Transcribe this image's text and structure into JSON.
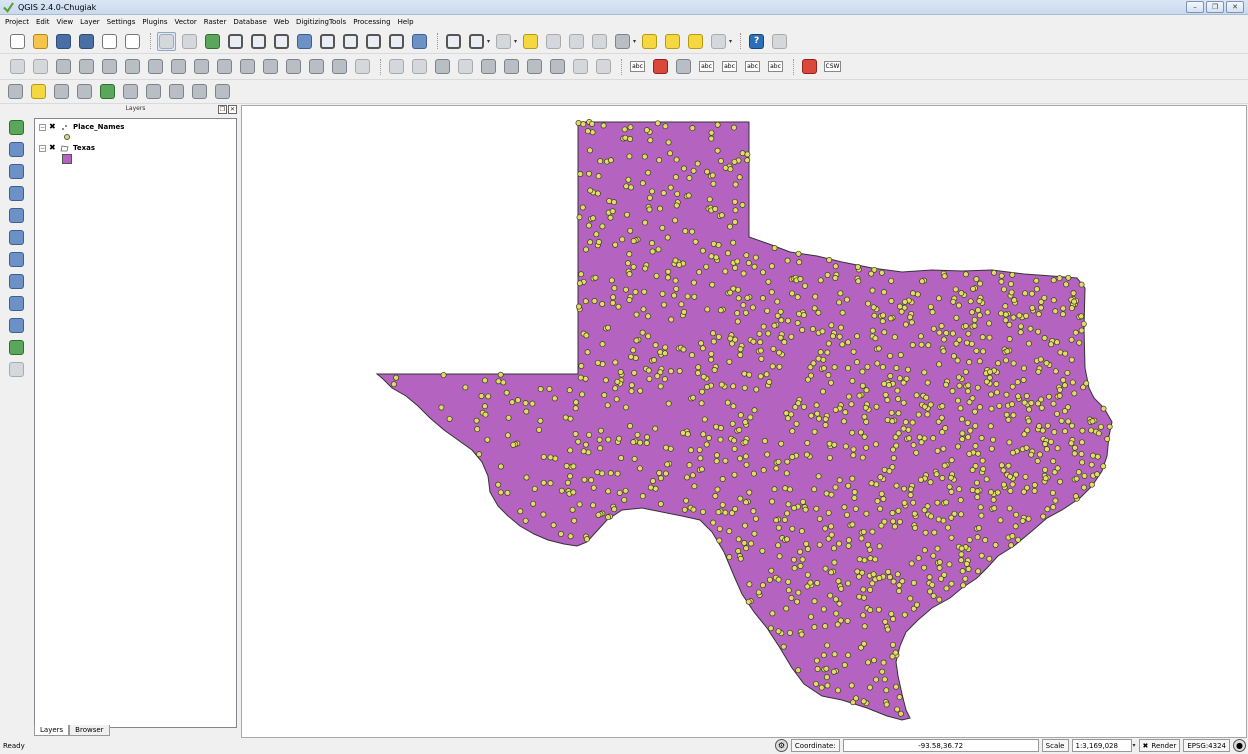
{
  "window": {
    "title": "QGIS 2.4.0-Chugiak",
    "buttons": [
      "–",
      "❐",
      "✕"
    ]
  },
  "menu": [
    "Project",
    "Edit",
    "View",
    "Layer",
    "Settings",
    "Plugins",
    "Vector",
    "Raster",
    "Database",
    "Web",
    "DigitizingTools",
    "Processing",
    "Help"
  ],
  "toolbar_labels": {
    "csw": "CSW",
    "label_a": "abc",
    "label_b": "abc",
    "label_c": "abc",
    "label_d": "abc",
    "label_e": "abc"
  },
  "layers_panel": {
    "title": "Layers",
    "float_button": "❐",
    "close_button": "✕",
    "layers": [
      {
        "name": "Place_Names",
        "checked": "✖",
        "expander": "−",
        "symbol_color": "#e0dc6a"
      },
      {
        "name": "Texas",
        "checked": "✖",
        "expander": "−",
        "symbol_color": "#b563c1"
      }
    ],
    "tabs": [
      "Layers",
      "Browser"
    ]
  },
  "map": {
    "polygon_fill": "#b563c1",
    "point_fill": "#e0dc6a",
    "point_stroke": "#3a3a1a"
  },
  "status": {
    "text": "Ready",
    "coordinate_label": "Coordinate:",
    "coordinate_value": "-93.58,36.72",
    "scale_label": "Scale",
    "scale_value": "1:3,169,028",
    "render_label": "Render",
    "render_check": "✖",
    "crs": "EPSG:4324"
  }
}
